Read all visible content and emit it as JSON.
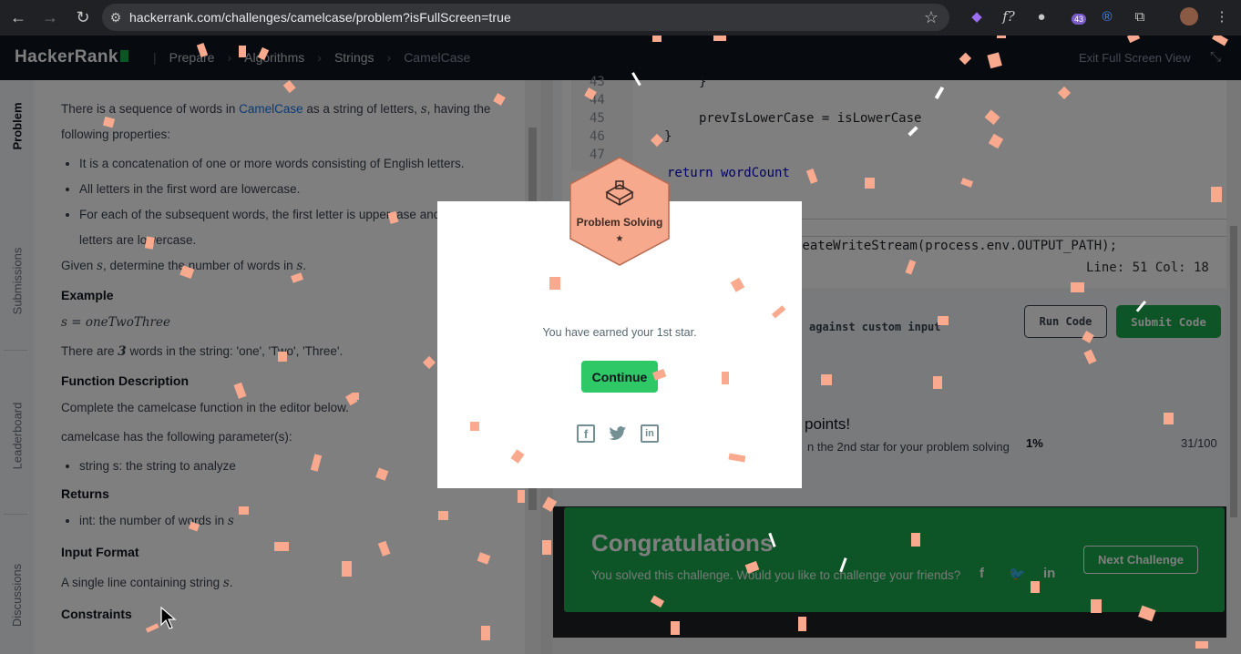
{
  "browser": {
    "url": "hackerrank.com/challenges/camelcase/problem?isFullScreen=true",
    "extension_badge": "43"
  },
  "header": {
    "logo": "HackerRank",
    "breadcrumbs": [
      "Prepare",
      "Algorithms",
      "Strings",
      "CamelCase"
    ],
    "exit_fullscreen": "Exit Full Screen View"
  },
  "rail": {
    "tabs": [
      "Problem",
      "Submissions",
      "Leaderboard",
      "Discussions"
    ]
  },
  "problem": {
    "intro_before_link": "There is a sequence of words in ",
    "intro_link": "CamelCase",
    "intro_after_link": " as a string of letters, ",
    "intro_var": "s",
    "intro_end": ", having the following properties:",
    "properties": [
      "It is a concatenation of one or more words consisting of English letters.",
      "All letters in the first word are lowercase.",
      "For each of the subsequent words, the first letter is uppercase and rest of the letters are lowercase."
    ],
    "given_pre": "Given ",
    "given_var": "s",
    "given_mid": ", determine the number of words in ",
    "given_var2": "s",
    "given_end": ".",
    "example_heading": "Example",
    "example_math": "s = oneTwoThree",
    "example_text_pre": "There are ",
    "example_count": "3",
    "example_text_post": " words in the string: 'one', 'Two', 'Three'.",
    "function_heading": "Function Description",
    "function_text": "Complete the camelcase function in the editor below.",
    "params_text": "camelcase has the following parameter(s):",
    "params": [
      "string s: the string to analyze"
    ],
    "returns_heading": "Returns",
    "returns_pre": "int: the number of words in ",
    "returns_var": "s",
    "input_heading": "Input Format",
    "input_pre": "A single line containing string ",
    "input_var": "s",
    "input_end": ".",
    "constraints_heading": "Constraints"
  },
  "editor": {
    "line_numbers": [
      "43",
      "44",
      "45",
      "46",
      "47"
    ],
    "lines": [
      "}",
      "prevIsLowerCase = isLowerCase",
      "}",
      "return wordCount"
    ],
    "write_stream_line": "reateWriteStream(process.env.OUTPUT_PATH);",
    "status": "Line: 51 Col: 18"
  },
  "actions": {
    "test_label": "against custom input",
    "run_code": "Run Code",
    "submit_code": "Submit Code",
    "points_text": "points!",
    "points_sub": "n the 2nd star for your problem solving",
    "percent": "1%",
    "progress": "31/100"
  },
  "congrats": {
    "title": "Congratulations",
    "subtitle": "You solved this challenge. Would you like to challenge your friends?",
    "next_challenge": "Next Challenge"
  },
  "modal": {
    "badge_label": "Problem Solving",
    "badge_stars": "★",
    "earned_text": "You have earned your 1st star.",
    "continue_label": "Continue"
  },
  "colors": {
    "accent_green": "#1ba94c",
    "continue_green": "#2ec866",
    "badge_peach": "#f7a98d",
    "confetti": "#f9a98e"
  }
}
